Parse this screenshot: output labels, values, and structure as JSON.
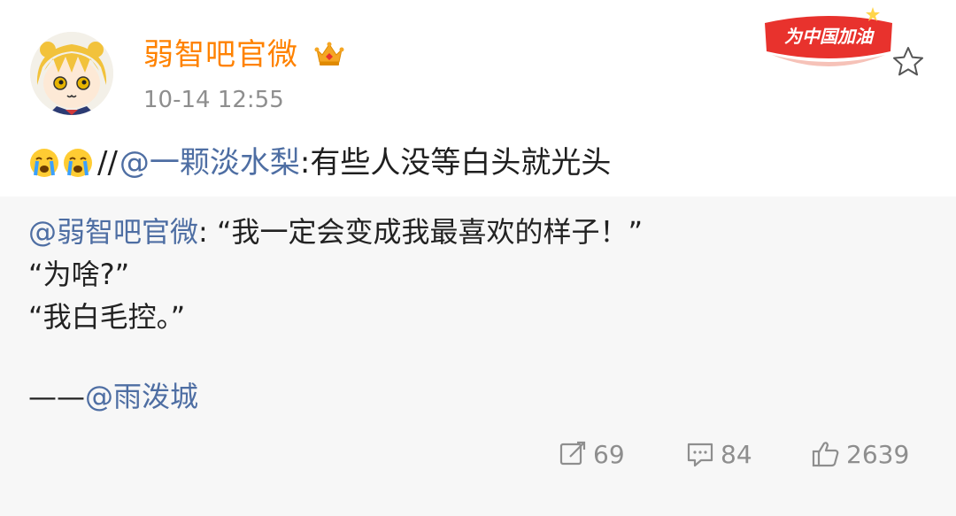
{
  "post": {
    "author": "弱智吧官微",
    "timestamp": "10-14 12:55",
    "repost_mention": "@一颗淡水梨",
    "repost_separator": "//",
    "repost_text": ":有些人没等白头就光头",
    "emojis": [
      "crying-emoji",
      "crying-emoji"
    ]
  },
  "promo": {
    "label": "为中国加油",
    "color": "#e8322d"
  },
  "original": {
    "mention": "@弱智吧官微",
    "line1_text": ": “我一定会变成我最喜欢的样子！”",
    "line2": "“为啥?”",
    "line3": "“我白毛控。”",
    "signature_dash": "——",
    "signature_mention": "@雨泼城"
  },
  "actions": {
    "repost_count": "69",
    "comment_count": "84",
    "like_count": "2639"
  },
  "colors": {
    "username": "#ff8200",
    "link": "#4e6ea3",
    "meta": "#8e8e8e",
    "original_bg": "#f7f7f7"
  },
  "icons": {
    "vip": "crown-badge-icon",
    "favorite": "star-icon",
    "repost": "repost-icon",
    "comment": "comment-icon",
    "like": "thumbs-up-icon"
  }
}
